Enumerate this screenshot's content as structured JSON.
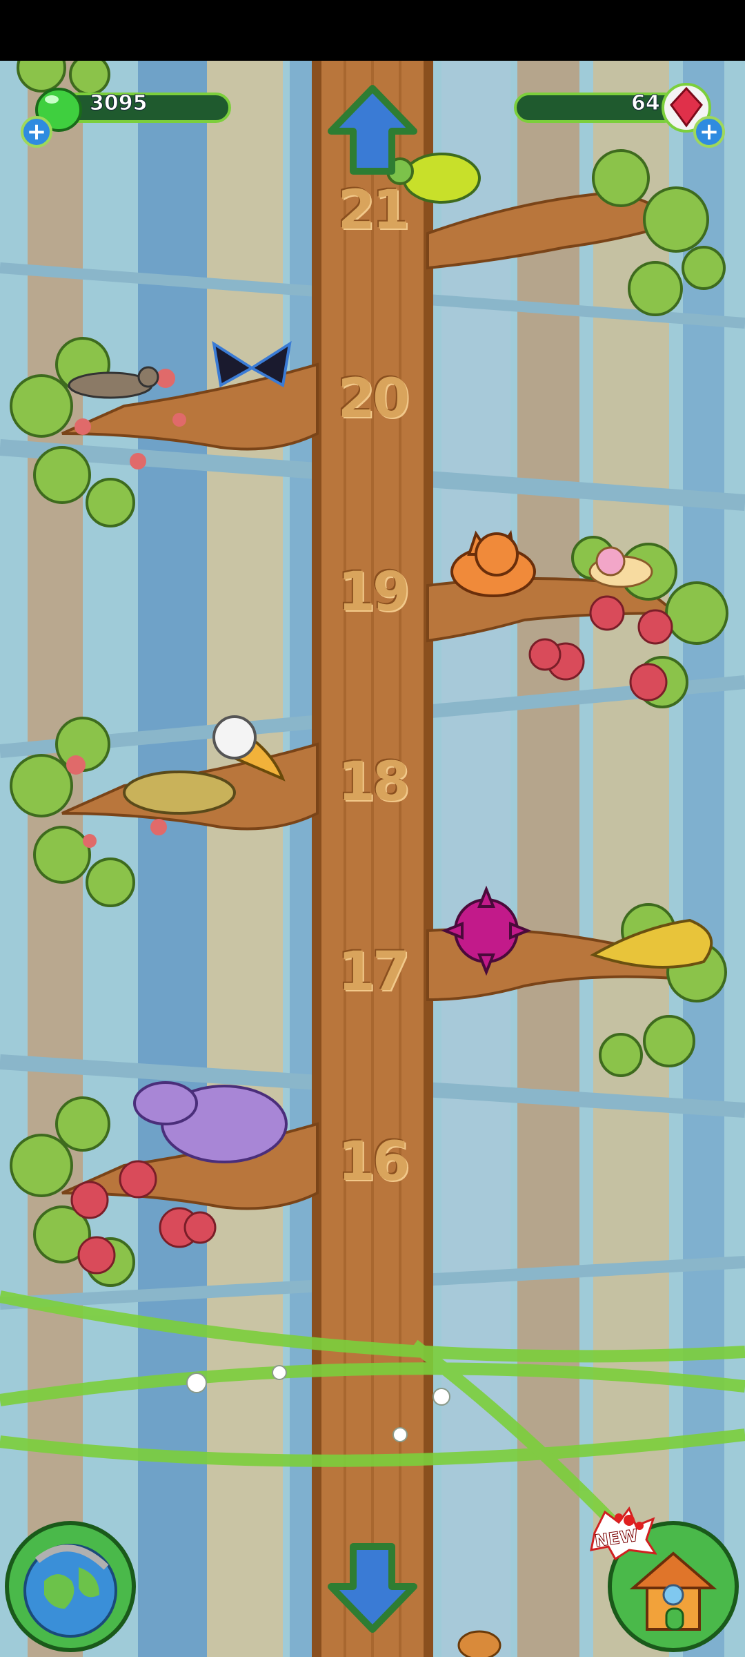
{
  "hud": {
    "gems_value": "3095",
    "crystals_value": "64"
  },
  "levels": [
    "21",
    "20",
    "19",
    "18",
    "17",
    "16"
  ],
  "home_button": {
    "badge": "NEW"
  },
  "colors": {
    "sky": "#9fcbd8",
    "trunk": "#b9763c",
    "leaf": "#8bc34a",
    "hud_bar": "#1f5a2e",
    "hud_border": "#7ccf3c",
    "plus_badge": "#2f8be0"
  },
  "icons": {
    "gem": "green-jelly-gem-icon",
    "crystal": "red-crystal-icon",
    "globe": "globe-icon",
    "home": "treehouse-icon",
    "up": "up-arrow-icon",
    "down": "down-arrow-icon"
  }
}
